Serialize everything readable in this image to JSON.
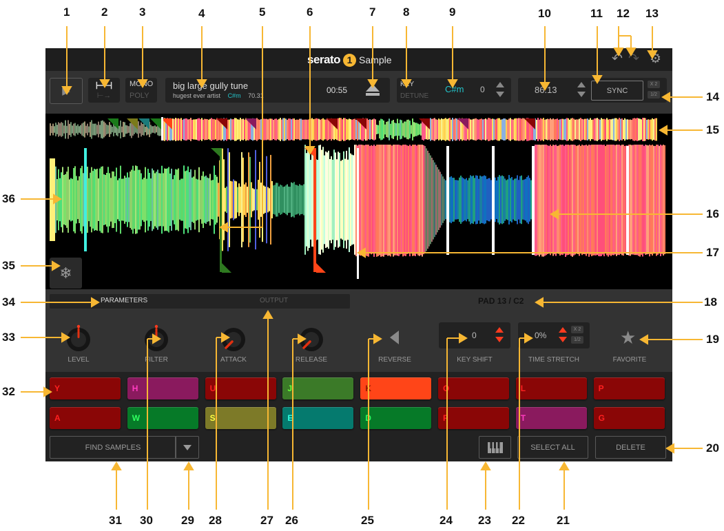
{
  "app": {
    "brand": "serato",
    "brand_badge": "1",
    "product": "Sample",
    "accent": "#f7b733"
  },
  "titlebar": {
    "undo_icon": "undo-icon",
    "redo_icon": "redo-icon",
    "settings_icon": "gear-icon"
  },
  "toolbar": {
    "play_icon": "play-icon",
    "playmode_top_icon": "trigger-mode-icon",
    "playmode_bottom_icon": "hold-mode-icon",
    "mono_label": "MONO",
    "poly_label": "POLY",
    "track": {
      "title": "big large gully tune",
      "artist": "hugest ever artist",
      "key": "C#m",
      "bpm": "70.31",
      "time": "00:55"
    },
    "key_label": "KEY",
    "detune_label": "DETUNE",
    "key_value": "C#m",
    "key_offset": "0",
    "bpm_value": "86.13",
    "sync_label": "SYNC",
    "double_label": "X 2",
    "half_label": "1/2"
  },
  "params": {
    "tabs": [
      {
        "label": "PARAMETERS",
        "active": true
      },
      {
        "label": "OUTPUT",
        "active": false
      }
    ],
    "pad_info": "PAD 13 / C2",
    "knobs": [
      {
        "label": "LEVEL",
        "value": 0.5
      },
      {
        "label": "FILTER",
        "value": 0.5
      },
      {
        "label": "ATTACK",
        "value": 0.0
      },
      {
        "label": "RELEASE",
        "value": 0.0
      }
    ],
    "reverse_label": "REVERSE",
    "key_shift_label": "KEY SHIFT",
    "key_shift_value": "0",
    "time_stretch_label": "TIME STRETCH",
    "time_stretch_value": "0%",
    "stretch_double": "X 2",
    "stretch_half": "1/2",
    "favorite_label": "FAVORITE"
  },
  "pads": {
    "row1": [
      {
        "key": "Y",
        "bg": "#8a0606",
        "fg": "#ff2020"
      },
      {
        "key": "H",
        "bg": "#8a1a5e",
        "fg": "#ff3cc0"
      },
      {
        "key": "U",
        "bg": "#8a0606",
        "fg": "#ff2020"
      },
      {
        "key": "J",
        "bg": "#3b7a28",
        "fg": "#6aff3a"
      },
      {
        "key": "K",
        "bg": "#ff4518",
        "fg": "#8a1a00"
      },
      {
        "key": "O",
        "bg": "#8a0606",
        "fg": "#ff2020"
      },
      {
        "key": "L",
        "bg": "#8a0606",
        "fg": "#ff2020"
      },
      {
        "key": "P",
        "bg": "#8a0606",
        "fg": "#ff2020"
      }
    ],
    "row2": [
      {
        "key": "A",
        "bg": "#8a0606",
        "fg": "#ff2020"
      },
      {
        "key": "W",
        "bg": "#067a28",
        "fg": "#30ff60"
      },
      {
        "key": "S",
        "bg": "#7d7a28",
        "fg": "#ffff40"
      },
      {
        "key": "E",
        "bg": "#057a6e",
        "fg": "#30ffe0"
      },
      {
        "key": "D",
        "bg": "#067a28",
        "fg": "#30ff60"
      },
      {
        "key": "F",
        "bg": "#8a0606",
        "fg": "#ff2020"
      },
      {
        "key": "T",
        "bg": "#8a1a5e",
        "fg": "#ff3cc0"
      },
      {
        "key": "G",
        "bg": "#8a0606",
        "fg": "#ff2020"
      }
    ]
  },
  "bottom": {
    "find_samples_label": "FIND SAMPLES",
    "piano_icon": "piano-keyboard-icon",
    "select_all_label": "SELECT ALL",
    "delete_label": "DELETE"
  },
  "waveform": {
    "freeze_icon": "snowflake-icon"
  },
  "callouts": [
    "1",
    "2",
    "3",
    "4",
    "5",
    "6",
    "7",
    "8",
    "9",
    "10",
    "11",
    "12",
    "13",
    "14",
    "15",
    "16",
    "17",
    "18",
    "19",
    "20",
    "21",
    "22",
    "23",
    "24",
    "25",
    "26",
    "27",
    "28",
    "29",
    "30",
    "31",
    "32",
    "33",
    "34",
    "35",
    "36"
  ]
}
